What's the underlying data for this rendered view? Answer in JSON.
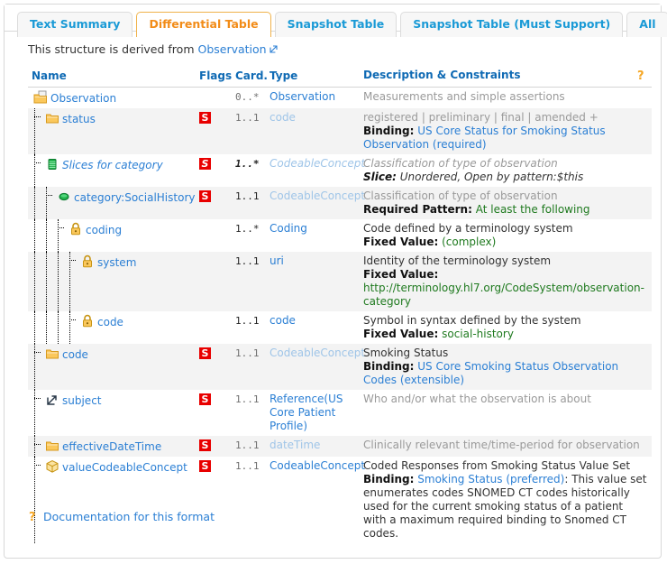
{
  "tabs": [
    {
      "label": "Text Summary",
      "active": false
    },
    {
      "label": "Differential Table",
      "active": true
    },
    {
      "label": "Snapshot Table",
      "active": false
    },
    {
      "label": "Snapshot Table (Must Support)",
      "active": false
    },
    {
      "label": "All",
      "active": false
    }
  ],
  "derived": {
    "prefix": "This structure is derived from ",
    "link": "Observation"
  },
  "table": {
    "headers": {
      "name": "Name",
      "flags": "Flags",
      "card": "Card.",
      "type": "Type",
      "desc": "Description & Constraints",
      "help_icon": "question-mark-icon"
    },
    "rows": [
      {
        "name": "Observation",
        "icon": "resource-folder-icon",
        "depth": 0,
        "flag": "",
        "card": "0..*",
        "card_style": "muted",
        "type": "Observation",
        "type_style": "link",
        "desc_html": "<span class='muted'>Measurements and simple assertions</span>"
      },
      {
        "name": "status",
        "icon": "element-folder-icon",
        "depth": 1,
        "flag": "S",
        "card": "1..1",
        "card_style": "muted",
        "type": "code",
        "type_style": "muted",
        "desc_html": "<span class='muted'>registered | preliminary | final | amended +</span><br><b>Binding:</b> <span class='lnk'>US Core Status for Smoking Status Observation</span> <span class='lnk'>(required)</span>"
      },
      {
        "name": "Slices for category",
        "icon": "slice-stack-icon",
        "depth": 1,
        "italic": true,
        "flag": "S",
        "flag_italic": true,
        "card": "1..*",
        "card_style": "bolditalic",
        "type": "CodeableConcept",
        "type_style": "italicmuted",
        "desc_html": "<span class='mutedit'>Classification of type of observation</span><br><span class='bi'>Slice:</span> <span class='it'>Unordered, Open by pattern:$this</span>"
      },
      {
        "name": "category:SocialHistory",
        "icon": "slice-item-icon",
        "depth": 2,
        "flag": "S",
        "card": "1..1",
        "card_style": "bold",
        "type": "CodeableConcept",
        "type_style": "muted",
        "desc_html": "<span class='muted'>Classification of type of observation</span><br><b>Required Pattern:</b> <span class='green'>At least the following</span>"
      },
      {
        "name": "coding",
        "icon": "lock-icon",
        "depth": 3,
        "flag": "",
        "card": "1..*",
        "card_style": "bold",
        "type": "Coding",
        "type_style": "link",
        "desc_html": "Code defined by a terminology system<br><b>Fixed Value:</b> <span class='green'>(complex)</span>"
      },
      {
        "name": "system",
        "icon": "lock-icon",
        "depth": 4,
        "flag": "",
        "card": "1..1",
        "card_style": "bold",
        "type": "uri",
        "type_style": "link",
        "desc_html": "Identity of the terminology system<br><b>Fixed Value:</b><br><span class='green'>http://terminology.hl7.org/CodeSystem/observation-category</span>"
      },
      {
        "name": "code",
        "icon": "lock-icon",
        "depth": 4,
        "flag": "",
        "card": "1..1",
        "card_style": "bold",
        "type": "code",
        "type_style": "link",
        "desc_html": "Symbol in syntax defined by the system<br><b>Fixed Value:</b> <span class='green'>social-history</span>"
      },
      {
        "name": "code",
        "icon": "element-folder-icon",
        "depth": 1,
        "flag": "S",
        "card": "1..1",
        "card_style": "muted",
        "type": "CodeableConcept",
        "type_style": "muted",
        "desc_html": "Smoking Status<br><b>Binding:</b> <span class='lnk'>US Core Smoking Status Observation Codes</span> <span class='lnk'>(extensible)</span>"
      },
      {
        "name": "subject",
        "icon": "reference-icon",
        "depth": 1,
        "flag": "S",
        "card": "1..1",
        "card_style": "muted",
        "type": "Reference(US Core Patient Profile)",
        "type_style": "link",
        "desc_html": "<span class='muted'>Who and/or what the observation is about</span>"
      },
      {
        "name": "effectiveDateTime",
        "icon": "element-folder-icon",
        "depth": 1,
        "flag": "S",
        "card": "1..1",
        "card_style": "muted",
        "type": "dateTime",
        "type_style": "muted",
        "desc_html": "<span class='muted'>Clinically relevant time/time-period for observation</span>"
      },
      {
        "name": "valueCodeableConcept",
        "icon": "choice-box-icon",
        "depth": 1,
        "flag": "S",
        "card": "1..1",
        "card_style": "muted",
        "type": "CodeableConcept",
        "type_style": "link",
        "desc_html": "Coded Responses from Smoking Status Value Set<br><b>Binding:</b> <span class='lnk'>Smoking Status</span> <span class='lnk'>(preferred)</span>: This value set enumerates codes SNOMED CT codes historically used for the current smoking status of a patient with a maximum required binding to Snomed CT codes."
      }
    ]
  },
  "footer": {
    "icon": "question-mark-icon",
    "label": "Documentation for this format"
  },
  "colors": {
    "accent_active_tab": "#f28c18",
    "link": "#2b7fd4",
    "flag_red": "#e80000",
    "fixed_value_green": "#1f7a1f",
    "header_blue": "#0f6ab4"
  }
}
